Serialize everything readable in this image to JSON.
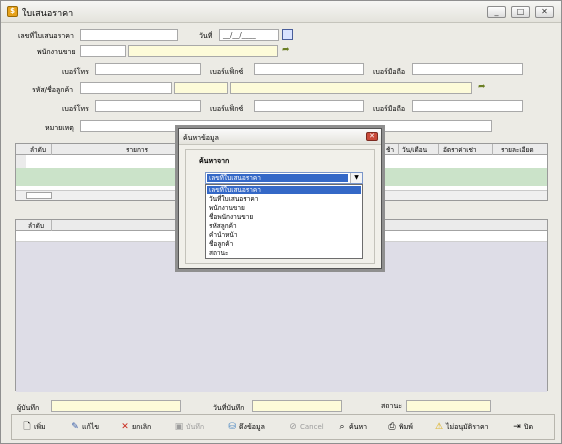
{
  "window": {
    "title": "ใบเสนอราคา",
    "app_icon_glyph": "$"
  },
  "form": {
    "quote_no_label": "เลขที่ใบเสนอราคา",
    "quote_no_value": "",
    "date_label": "วันที่",
    "date_value": "__/__/____",
    "salesperson_label": "พนักงานขาย",
    "phone_label_1": "เบอร์โทร",
    "fax_label_1": "เบอร์แฟ็กซ์",
    "mobile_label_1": "เบอร์มือถือ",
    "customer_label": "รหัส/ชื่อลูกค้า",
    "phone_label_2": "เบอร์โทร",
    "fax_label_2": "เบอร์แฟ็กซ์",
    "mobile_label_2": "เบอร์มือถือ",
    "note_label": "หมายเหตุ"
  },
  "grid1": {
    "columns": [
      "ลำดับ",
      "รายการ",
      "ช้า",
      "วัน/เดือน",
      "อัตราค่าเช่า",
      "รายละเอียด"
    ]
  },
  "grid2": {
    "columns": [
      "ลำดับ"
    ]
  },
  "footer": {
    "recorder_label": "ผู้บันทึก",
    "record_date_label": "วันที่บันทึก",
    "status_label": "สถานะ"
  },
  "toolbar": {
    "buttons": [
      {
        "label": "เพิ่ม",
        "icon": "document-icon",
        "disabled": false
      },
      {
        "label": "แก้ไข",
        "icon": "edit-icon",
        "disabled": false
      },
      {
        "label": "ยกเลิก",
        "icon": "cross-icon",
        "disabled": false
      },
      {
        "label": "บันทึก",
        "icon": "save-icon",
        "disabled": true
      },
      {
        "label": "ดึงข้อมูล",
        "icon": "retrieve-icon",
        "disabled": false
      },
      {
        "label": "Cancel",
        "icon": "cancel-icon",
        "disabled": true
      },
      {
        "label": "ค้นหา",
        "icon": "binoculars-icon",
        "disabled": false
      },
      {
        "label": "พิมพ์",
        "icon": "print-icon",
        "disabled": false
      },
      {
        "label": "ไม่อนุมัติราคา",
        "icon": "warning-icon",
        "disabled": false
      },
      {
        "label": "ปิด",
        "icon": "exit-icon",
        "disabled": false
      }
    ]
  },
  "dialog": {
    "title": "ค้นหาข้อมูล",
    "search_by_label": "ค้นหาจาก",
    "selected_value": "เลขที่ใบเสนอราคา",
    "options": [
      "เลขที่ใบเสนอราคา",
      "วันที่ใบเสนอราคา",
      "พนักงานขาย",
      "ชื่อพนักงานขาย",
      "รหัสลูกค้า",
      "คำนำหน้า",
      "ชื่อลูกค้า",
      "สถานะ"
    ],
    "selected_index": 0
  },
  "colors": {
    "highlight": "#3468c7",
    "grid_row_green": "#cbe3c9",
    "yellow_field": "#fdfbd9"
  }
}
